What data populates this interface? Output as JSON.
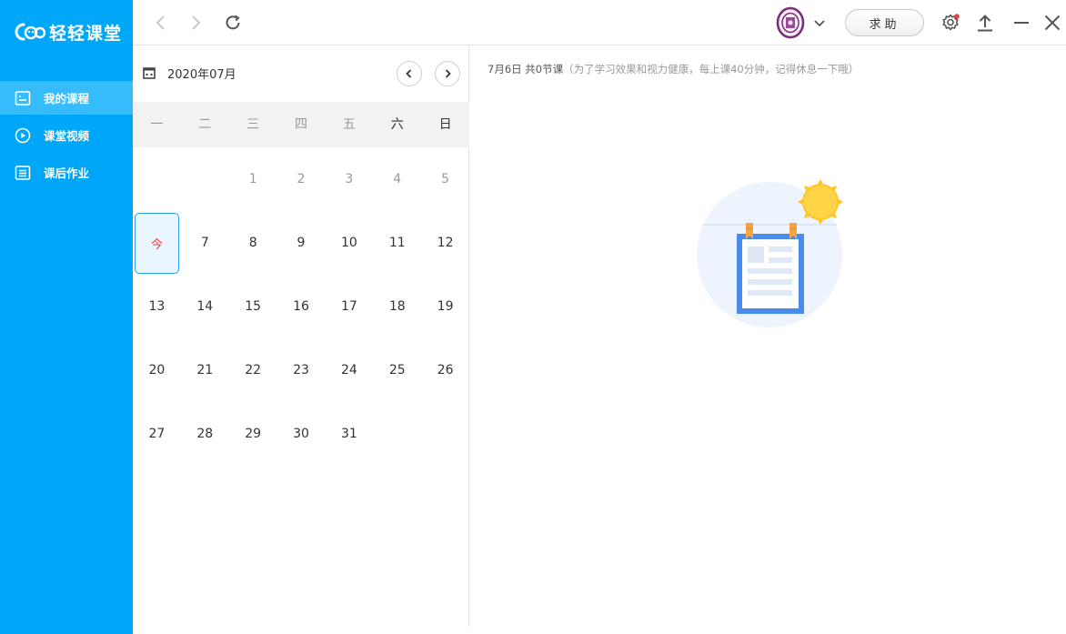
{
  "app": {
    "name": "轻轻课堂"
  },
  "sidebar": {
    "items": [
      {
        "label": "我的课程",
        "icon": "course-list-icon",
        "active": true
      },
      {
        "label": "课堂视频",
        "icon": "play-circle-icon",
        "active": false
      },
      {
        "label": "课后作业",
        "icon": "homework-icon",
        "active": false
      }
    ]
  },
  "topbar": {
    "help_label": "求助",
    "back_icon": "chevron-left-icon",
    "forward_icon": "chevron-right-icon",
    "refresh_icon": "refresh-icon",
    "settings_icon": "gear-icon",
    "upload_icon": "upload-icon",
    "minimize_icon": "minimize-icon",
    "close_icon": "close-icon",
    "settings_badge_color": "#e8413c"
  },
  "calendar": {
    "month_label": "2020年07月",
    "weekdays": [
      "一",
      "二",
      "三",
      "四",
      "五",
      "六",
      "日"
    ],
    "weeks": [
      [
        "",
        "",
        "1",
        "2",
        "3",
        "4",
        "5"
      ],
      [
        "今",
        "7",
        "8",
        "9",
        "10",
        "11",
        "12"
      ],
      [
        "13",
        "14",
        "15",
        "16",
        "17",
        "18",
        "19"
      ],
      [
        "20",
        "21",
        "22",
        "23",
        "24",
        "25",
        "26"
      ],
      [
        "27",
        "28",
        "29",
        "30",
        "31",
        "",
        ""
      ]
    ],
    "today_label": "今"
  },
  "main": {
    "date_summary": "7月6日 共0节课",
    "hint": "（为了学习效果和视力健康，每上课40分钟，记得休息一下哦）"
  },
  "colors": {
    "brand": "#00a6f8",
    "active_nav": "#36bcfb",
    "today_border": "#2aa3f5",
    "today_text": "#e8413c"
  }
}
